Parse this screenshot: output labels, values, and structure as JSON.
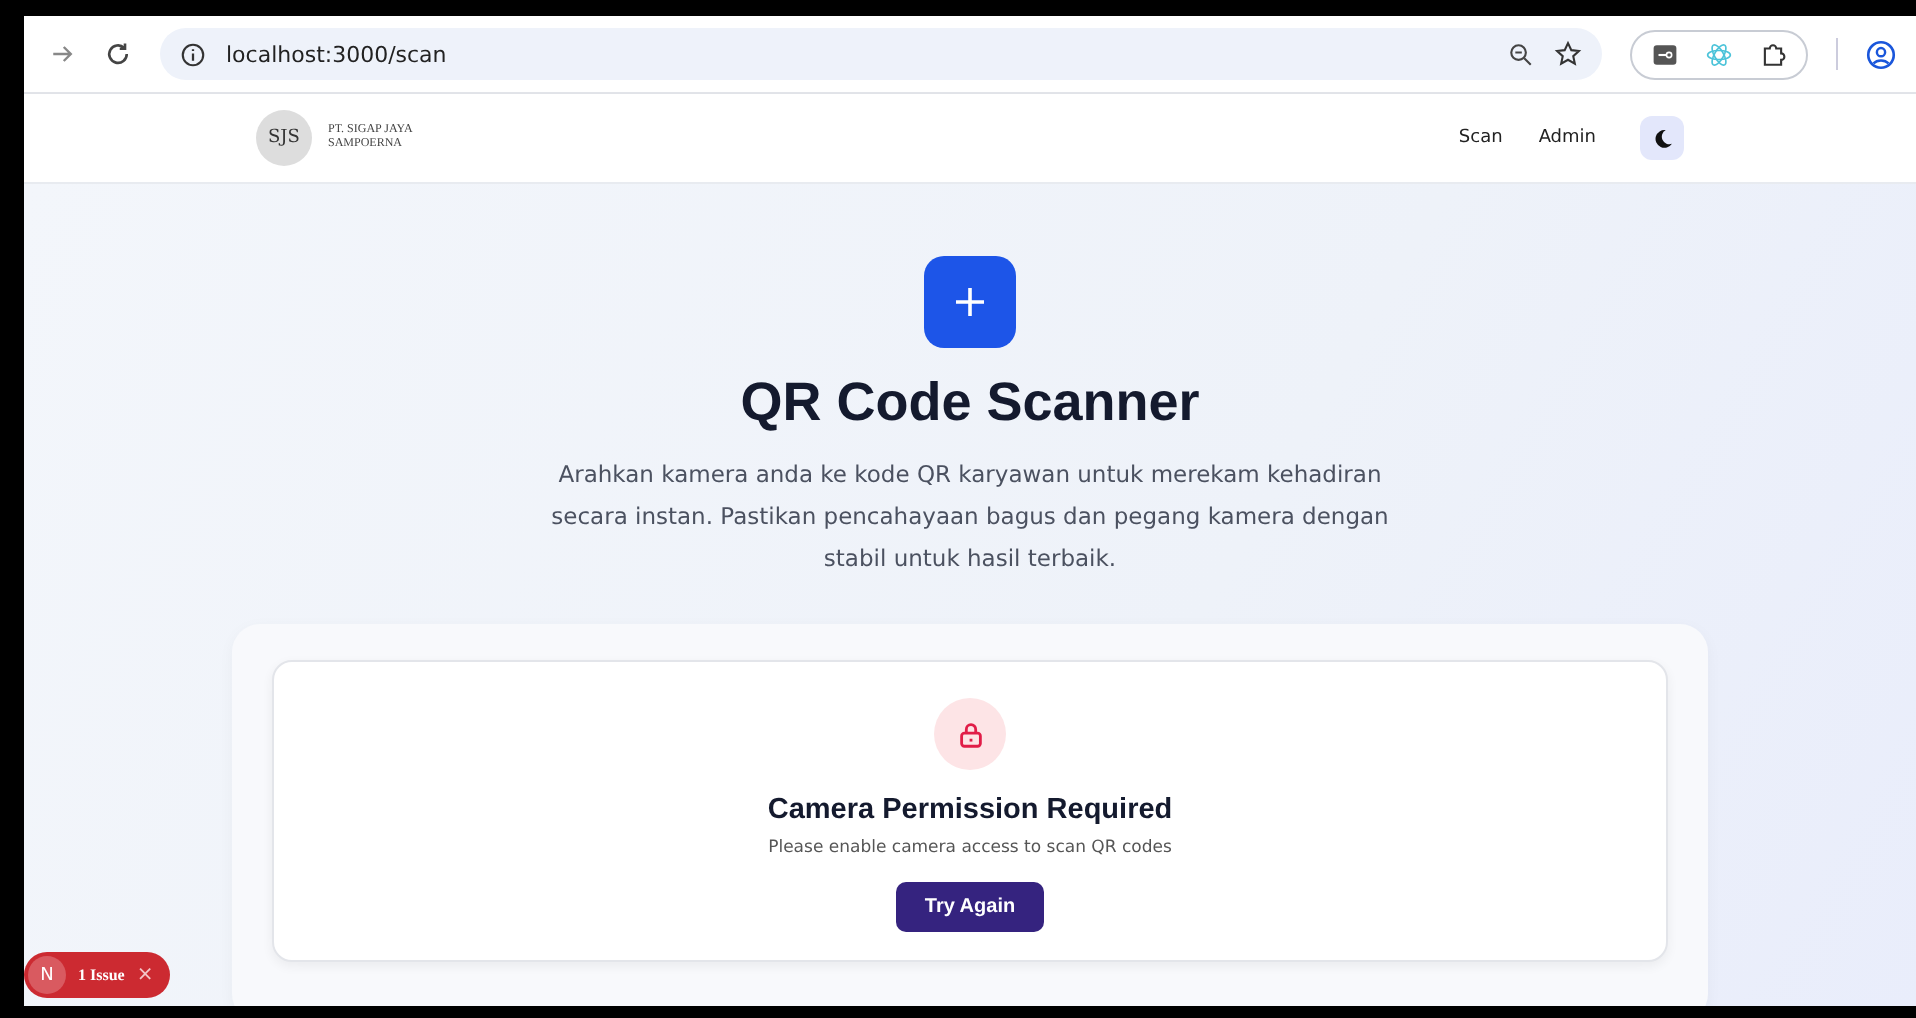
{
  "browser": {
    "url": "localhost:3000/scan"
  },
  "header": {
    "logo_mark": "SJS",
    "logo_lines": [
      "PT. SIGAP JAYA",
      "SAMPOERNA"
    ],
    "nav": [
      {
        "label": "Scan"
      },
      {
        "label": "Admin"
      }
    ]
  },
  "hero": {
    "title": "QR Code Scanner",
    "description": "Arahkan kamera anda ke kode QR karyawan untuk merekam kehadiran secara instan. Pastikan pencahayaan bagus dan pegang kamera dengan stabil untuk hasil terbaik."
  },
  "permission_card": {
    "title": "Camera Permission Required",
    "message": "Please enable camera access to scan QR codes",
    "button": "Try Again"
  },
  "issues_badge": {
    "letter": "N",
    "label": "1 Issue",
    "close": "×"
  }
}
